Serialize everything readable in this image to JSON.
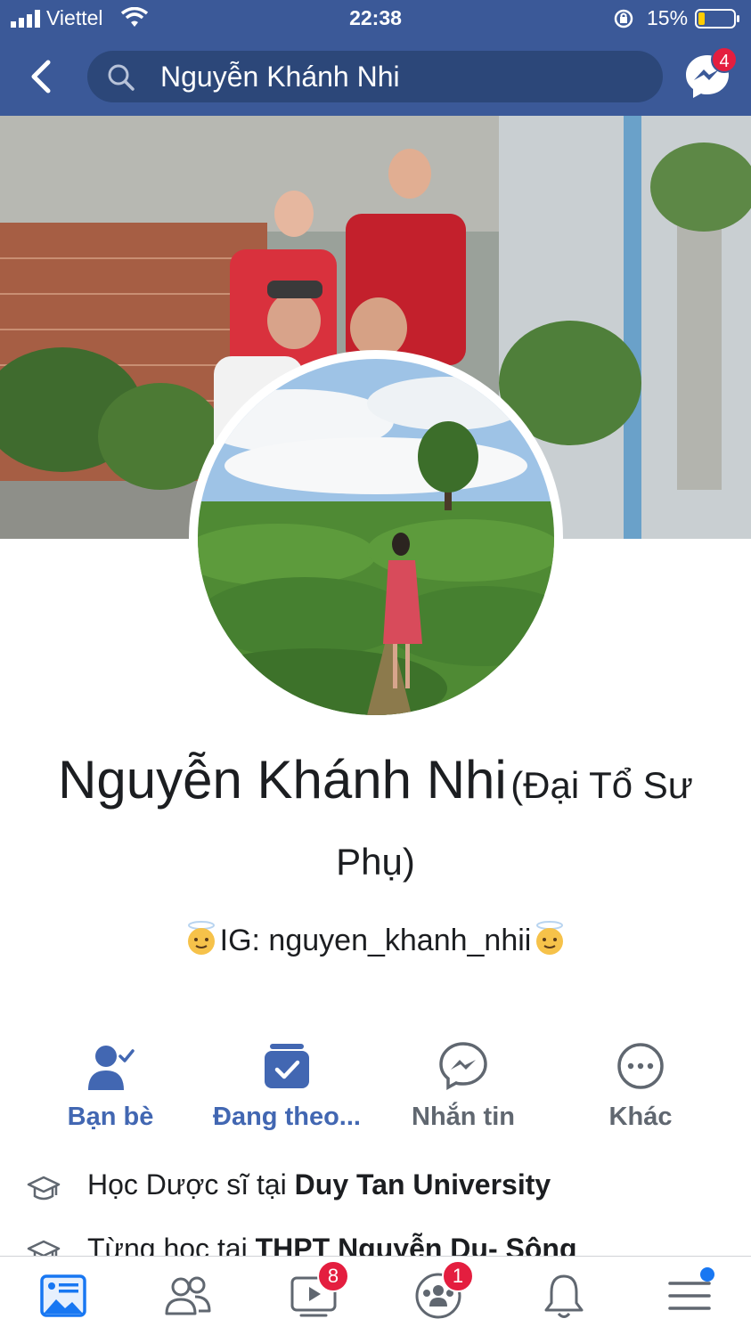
{
  "status_bar": {
    "carrier": "Viettel",
    "time": "22:38",
    "battery": "15%"
  },
  "header": {
    "search_value": "Nguyễn Khánh Nhi",
    "messenger_badge": "4"
  },
  "profile": {
    "name": "Nguyễn Khánh Nhi",
    "alternate_name": "(Đại Tổ Sư Phụ)",
    "bio": "IG: nguyen_khanh_nhii"
  },
  "actions": [
    {
      "label": "Bạn bè"
    },
    {
      "label": "Đang theo..."
    },
    {
      "label": "Nhắn tin"
    },
    {
      "label": "Khác"
    }
  ],
  "intro": [
    {
      "prefix": "Học Dược sĩ tại ",
      "place": "Duy Tan University"
    },
    {
      "prefix": "Từng học tại ",
      "place": "THPT Nguyễn Du- Sông"
    }
  ],
  "bottom_nav": {
    "video_badge": "8",
    "groups_badge": "1"
  },
  "colors": {
    "brand": "#3b5998",
    "accent": "#4267b2",
    "badge": "#e41e3f"
  }
}
